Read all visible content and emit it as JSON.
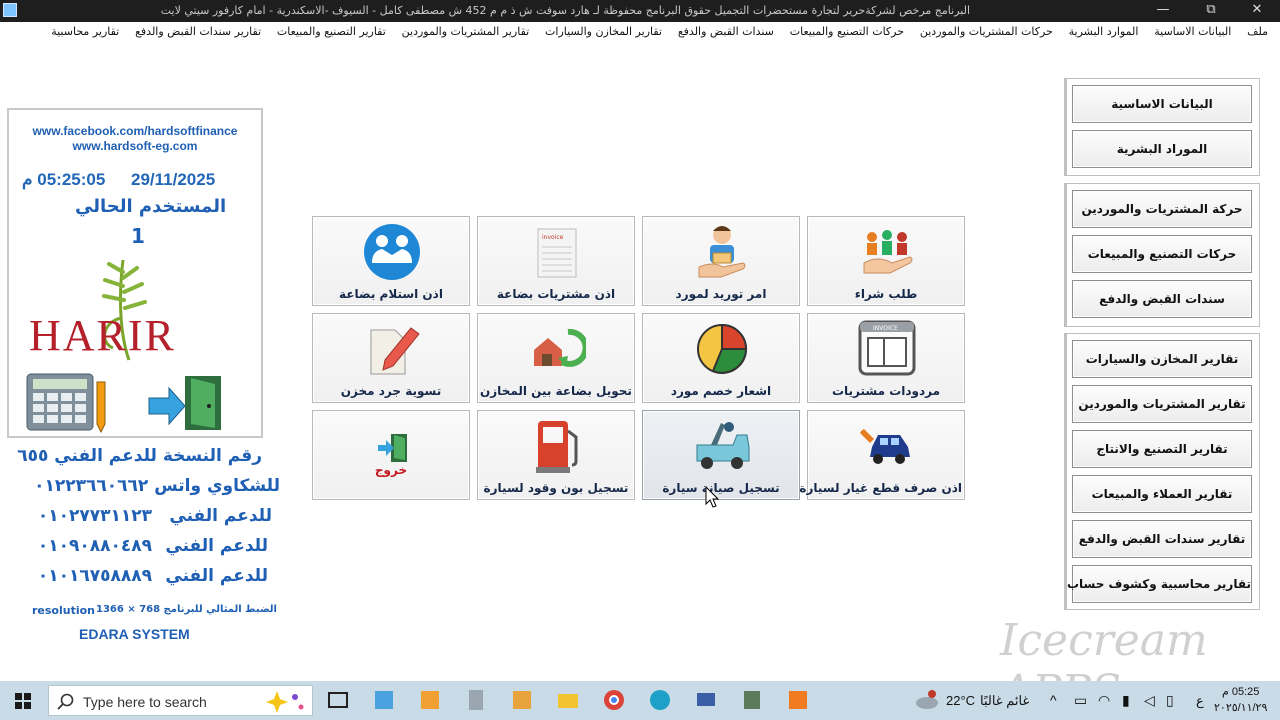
{
  "window": {
    "title": "البرنامج مرخص لشركةحرير لتجارة مستحضرات التجميل     حقوق البرنامج محفوظة لـ هارد سوفت ش ذ م م    452 ش مصطفى كامل - السيوف -الاسكندرية - امام كارفور سيتي لايت",
    "minimize": "—",
    "maximize": "⧉",
    "close": "✕"
  },
  "menu": [
    "ملف",
    "البيانات الاساسية",
    "الموارد البشرية",
    "حركات المشتريات والموردين",
    "حركات التصنيع والمبيعات",
    "سندات القبض والدفع",
    "تقارير المخازن والسيارات",
    "تقارير المشتريات والموردين",
    "تقارير التصنيع والمبيعات",
    "تقارير سندات القبض والدفع",
    "تقارير محاسبية"
  ],
  "info": {
    "facebook": "www.facebook.com/hardsoftfinance",
    "website": "www.hardsoft-eg.com",
    "date": "29/11/2025",
    "time": "05:25:05 م",
    "current_user_label": "المستخدم الحالي",
    "current_user": "1",
    "logo_text": "HARIR"
  },
  "support": {
    "version_line": "رقم النسخة للدعم الفني ٦٥٥",
    "whatsapp_line": "للشكاوي واتس  ٠١٢٢٣٦٦٠٦٦٢",
    "support1_label": "للدعم الفني",
    "support1_number": "٠١٠٢٧٧٣١١٢٣",
    "support2_label": "للدعم الفني",
    "support2_number": "٠١٠٩٠٨٨٠٤٨٩",
    "support3_label": "للدعم الفني",
    "support3_number": "٠١٠١٦٧٥٨٨٨٩",
    "resolution_note": "الضبط المثالي للبرنامج 768 × 1366",
    "resolution_word": "resolution",
    "system_name": "EDARA SYSTEM"
  },
  "tiles": {
    "row1": [
      "طلب شراء",
      "امر توريد لمورد",
      "اذن مشتريات بضاعة",
      "اذن استلام بضاعة"
    ],
    "row2": [
      "مردودات مشتريات",
      "اشعار خصم مورد",
      "تحويل بضاعة بين المخازن",
      "تسوية جرد مخزن"
    ],
    "row3": [
      "اذن صرف قطع غيار لسيارة",
      "تسجيل صيانة سيارة",
      "تسجيل بون وقود لسيارة",
      "خروج"
    ]
  },
  "sidebar": {
    "group1": [
      "البيانات الاساسية",
      "الموراد البشرية"
    ],
    "group2": [
      "حركة المشتريات والموردين",
      "حركات التصنيع والمبيعات",
      "سندات القبض والدفع"
    ],
    "group3": [
      "تقارير المخازن والسيارات",
      "تقارير المشتريات والموردين",
      "تقارير التصنيع والانتاج",
      "تقارير العملاء والمبيعات",
      "تقارير سندات القبض والدفع",
      "تقارير محاسبية وكشوف حساب"
    ]
  },
  "taskbar": {
    "search_placeholder": "Type here to search",
    "temperature": "22°C",
    "weather": "غائم غالبًا",
    "lang": "ع",
    "clock_time": "05:25 م",
    "clock_date": "٢٠٢٥/١١/٢٩"
  },
  "watermark": "Icecream APPS",
  "colors": {
    "accent_blue": "#1f5fb4",
    "logo_red": "#b5202a",
    "exit_red": "#c3151b",
    "taskbar": "#c9dbe6"
  }
}
